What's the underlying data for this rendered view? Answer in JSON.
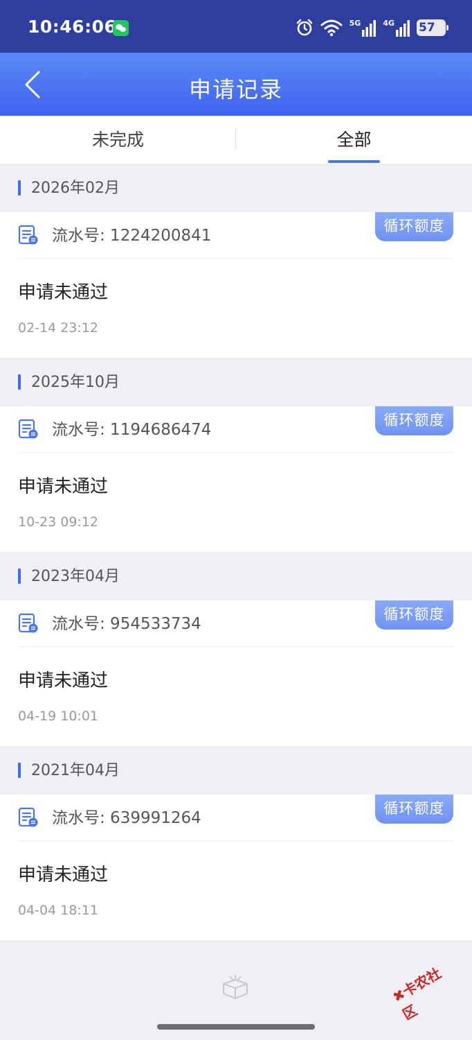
{
  "status_bar": {
    "time": "10:46:06",
    "battery": "57",
    "signal_labels": [
      "5G",
      "4G"
    ]
  },
  "header": {
    "title": "申请记录"
  },
  "tabs": [
    {
      "label": "未完成",
      "active": false
    },
    {
      "label": "全部",
      "active": true
    }
  ],
  "records": [
    {
      "month": "2026年02月",
      "serial": "流水号: 1224200841",
      "tag": "循环额度",
      "status": "申请未通过",
      "time": "02-14 23:12"
    },
    {
      "month": "2025年10月",
      "serial": "流水号: 1194686474",
      "tag": "循环额度",
      "status": "申请未通过",
      "time": "10-23 09:12"
    },
    {
      "month": "2023年04月",
      "serial": "流水号: 954533734",
      "tag": "循环额度",
      "status": "申请未通过",
      "time": "04-19 10:01"
    },
    {
      "month": "2021年04月",
      "serial": "流水号: 639991264",
      "tag": "循环额度",
      "status": "申请未通过",
      "time": "04-04 18:11"
    }
  ],
  "watermark": "卡农社区",
  "colors": {
    "status_bar": "#2d3e9e",
    "header_gradient_top": "#5a8af5",
    "header_gradient_bottom": "#3f63ef",
    "accent": "#4a74ee",
    "tag": "#7b9cf5"
  }
}
